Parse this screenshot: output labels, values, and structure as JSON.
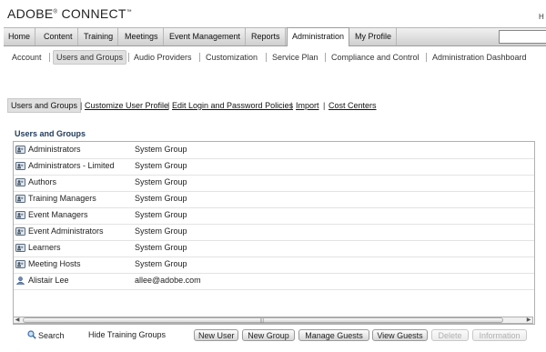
{
  "app": {
    "logo": "ADOBE",
    "logo_reg": "®",
    "logo_rest": " CONNECT",
    "logo_tm": "™",
    "user_initial": "H"
  },
  "topnav": [
    "Home",
    "Content",
    "Training",
    "Meetings",
    "Event Management",
    "Reports",
    "Administration",
    "My Profile"
  ],
  "topnav_active": "Administration",
  "subnav": [
    "Account",
    "Users and Groups",
    "Audio Providers",
    "Customization",
    "Service Plan",
    "Compliance and Control",
    "Administration Dashboard"
  ],
  "subnav_active": "Users and Groups",
  "pagelinks": [
    "Users and Groups",
    "Customize User Profile",
    "Edit Login and Password Policies",
    "Import",
    "Cost Centers"
  ],
  "pagelinks_sep": "|",
  "section_title": "Users and Groups",
  "rows": [
    {
      "name": "Administrators",
      "type": "System Group",
      "icon": "group-icon"
    },
    {
      "name": "Administrators - Limited",
      "type": "System Group",
      "icon": "group-icon"
    },
    {
      "name": "Authors",
      "type": "System Group",
      "icon": "group-icon"
    },
    {
      "name": "Training Managers",
      "type": "System Group",
      "icon": "group-icon"
    },
    {
      "name": "Event Managers",
      "type": "System Group",
      "icon": "group-icon"
    },
    {
      "name": "Event Administrators",
      "type": "System Group",
      "icon": "group-icon"
    },
    {
      "name": "Learners",
      "type": "System Group",
      "icon": "group-icon"
    },
    {
      "name": "Meeting Hosts",
      "type": "System Group",
      "icon": "group-icon"
    },
    {
      "name": "Alistair Lee",
      "type": "allee@adobe.com",
      "icon": "user-icon"
    }
  ],
  "bottom": {
    "search": "Search",
    "hide_training": "Hide Training Groups",
    "buttons": [
      "New User",
      "New Group",
      "Manage Guests",
      "View Guests",
      "Delete",
      "Information"
    ],
    "disabled_buttons": [
      "Delete",
      "Information"
    ]
  },
  "colors": {
    "section_title": "#1f3a5a",
    "nav_gradient_top": "#f1f1f1",
    "nav_gradient_bottom": "#cfcfcf"
  }
}
